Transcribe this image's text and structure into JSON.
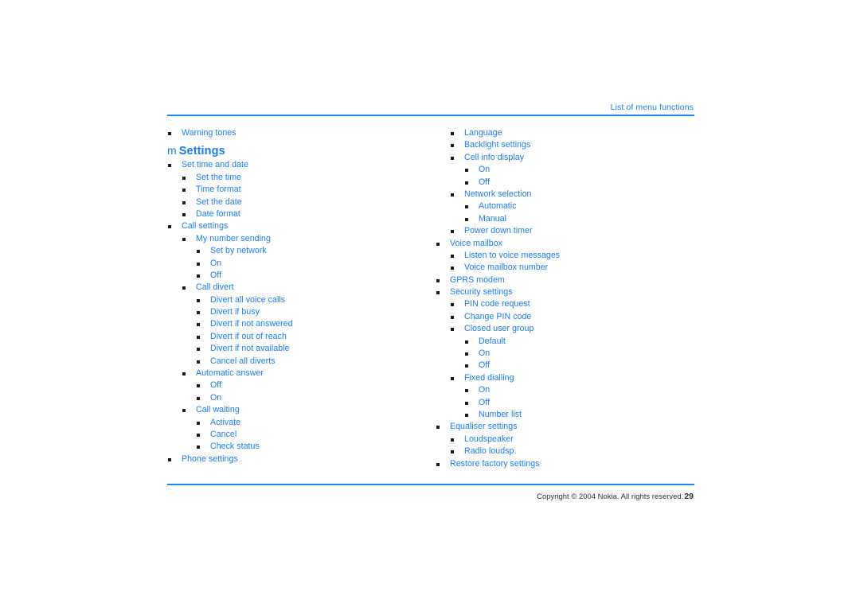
{
  "header": {
    "running_title": "List of menu functions"
  },
  "footer": {
    "copyright": "Copyright © 2004 Nokia. All rights reserved.",
    "page_number": "29"
  },
  "colors": {
    "link_blue": "#1a7cf0",
    "rule_blue": "#1a86f5",
    "bullet_dark": "#1c1c1c",
    "footer_text": "#2b2b2b",
    "page_background": "#ffffff"
  },
  "left_column": {
    "pre_heading_items": [
      {
        "level": 1,
        "label": "Warning tones"
      }
    ],
    "heading": {
      "symbol": "m",
      "text": "Settings"
    },
    "items": [
      {
        "level": 1,
        "label": "Set time and date"
      },
      {
        "level": 2,
        "label": "Set the time"
      },
      {
        "level": 2,
        "label": "Time format"
      },
      {
        "level": 2,
        "label": "Set the date"
      },
      {
        "level": 2,
        "label": "Date format"
      },
      {
        "level": 1,
        "label": "Call settings"
      },
      {
        "level": 2,
        "label": "My number sending"
      },
      {
        "level": 3,
        "label": "Set by network"
      },
      {
        "level": 3,
        "label": "On"
      },
      {
        "level": 3,
        "label": "Off"
      },
      {
        "level": 2,
        "label": "Call divert"
      },
      {
        "level": 3,
        "label": "Divert all voice calls"
      },
      {
        "level": 3,
        "label": "Divert if busy"
      },
      {
        "level": 3,
        "label": "Divert if not answered"
      },
      {
        "level": 3,
        "label": "Divert if out of reach"
      },
      {
        "level": 3,
        "label": "Divert if not available"
      },
      {
        "level": 3,
        "label": "Cancel all diverts"
      },
      {
        "level": 2,
        "label": "Automatic answer"
      },
      {
        "level": 3,
        "label": "Off"
      },
      {
        "level": 3,
        "label": "On"
      },
      {
        "level": 2,
        "label": "Call waiting"
      },
      {
        "level": 3,
        "label": "Activate"
      },
      {
        "level": 3,
        "label": "Cancel"
      },
      {
        "level": 3,
        "label": "Check status"
      },
      {
        "level": 1,
        "label": "Phone settings"
      }
    ]
  },
  "right_column": {
    "items": [
      {
        "level": 2,
        "label": "Language"
      },
      {
        "level": 2,
        "label": "Backlight settings"
      },
      {
        "level": 2,
        "label": "Cell info display"
      },
      {
        "level": 3,
        "label": "On"
      },
      {
        "level": 3,
        "label": "Off"
      },
      {
        "level": 2,
        "label": "Network selection"
      },
      {
        "level": 3,
        "label": "Automatic"
      },
      {
        "level": 3,
        "label": "Manual"
      },
      {
        "level": 2,
        "label": "Power down timer"
      },
      {
        "level": 1,
        "label": "Voice mailbox"
      },
      {
        "level": 2,
        "label": "Listen to voice messages"
      },
      {
        "level": 2,
        "label": "Voice mailbox number"
      },
      {
        "level": 1,
        "label": "GPRS modem"
      },
      {
        "level": 1,
        "label": "Security settings"
      },
      {
        "level": 2,
        "label": "PIN code request"
      },
      {
        "level": 2,
        "label": "Change PIN code"
      },
      {
        "level": 2,
        "label": "Closed user group"
      },
      {
        "level": 3,
        "label": "Default"
      },
      {
        "level": 3,
        "label": "On"
      },
      {
        "level": 3,
        "label": "Off"
      },
      {
        "level": 2,
        "label": "Fixed dialling"
      },
      {
        "level": 3,
        "label": "On"
      },
      {
        "level": 3,
        "label": "Off"
      },
      {
        "level": 3,
        "label": "Number list"
      },
      {
        "level": 1,
        "label": "Equaliser settings"
      },
      {
        "level": 2,
        "label": "Loudspeaker"
      },
      {
        "level": 2,
        "label": "Radio loudsp."
      },
      {
        "level": 1,
        "label": "Restore factory settings"
      }
    ]
  }
}
